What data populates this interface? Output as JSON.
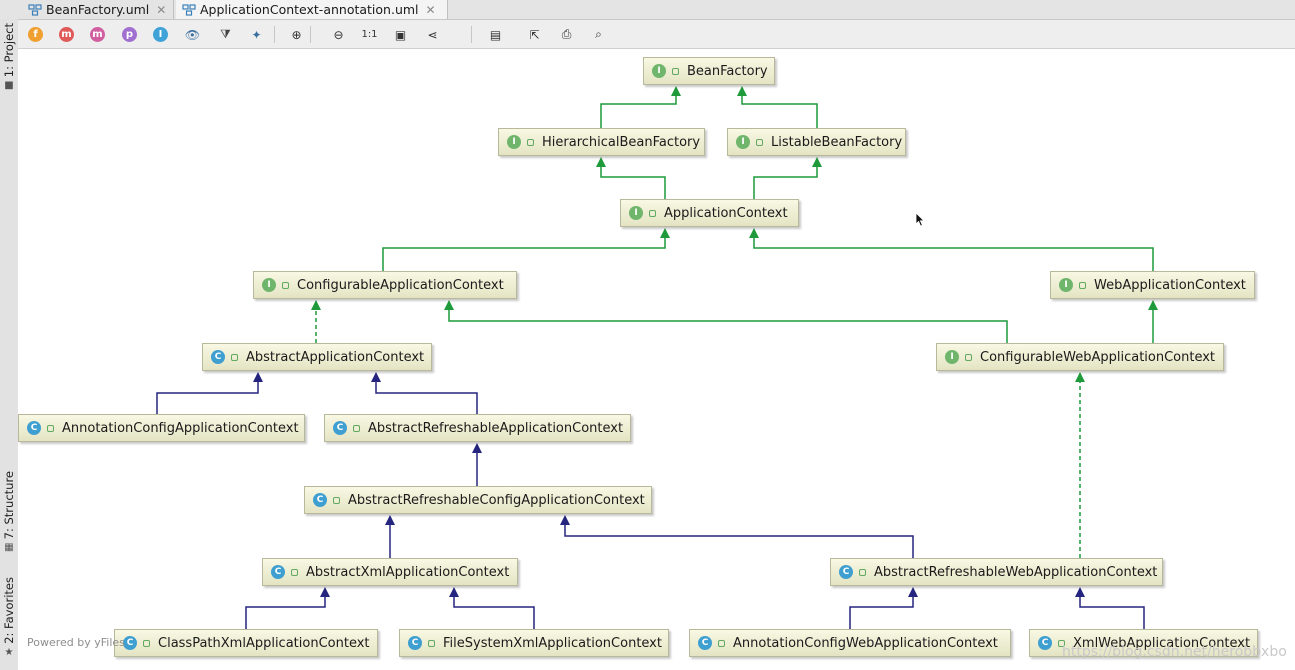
{
  "tabs": [
    {
      "label": "BeanFactory.uml",
      "active": false
    },
    {
      "label": "ApplicationContext-annotation.uml",
      "active": true
    }
  ],
  "sidebar": [
    {
      "label": "1: Project",
      "icon": "folder-icon"
    },
    {
      "label": "7: Structure",
      "icon": "structure-icon"
    },
    {
      "label": "2: Favorites",
      "icon": "star-icon"
    }
  ],
  "toolbar": [
    {
      "name": "fields-toggle",
      "glyph": "f",
      "color": "#f0a030"
    },
    {
      "name": "constructors-toggle",
      "glyph": "m",
      "color": "#e05a5a"
    },
    {
      "name": "methods-toggle",
      "glyph": "m",
      "color": "#d060a0"
    },
    {
      "name": "properties-toggle",
      "glyph": "p",
      "color": "#a070d0"
    },
    {
      "name": "inner-classes-toggle",
      "glyph": "I",
      "color": "#3fa3d8"
    },
    {
      "name": "visibility",
      "glyph": "👁",
      "color": "#3a6fa0"
    },
    {
      "name": "filter",
      "glyph": "⧩",
      "color": "#444444"
    },
    {
      "name": "layout",
      "glyph": "✦",
      "color": "#3a6fa0"
    },
    {
      "name": "zoom-in",
      "glyph": "⊕",
      "color": "#333333"
    },
    {
      "name": "zoom-out",
      "glyph": "⊖",
      "color": "#333333"
    },
    {
      "name": "actual-size",
      "glyph": "1:1",
      "color": "#333333"
    },
    {
      "name": "fit-content",
      "glyph": "▣",
      "color": "#333333"
    },
    {
      "name": "share",
      "glyph": "⋖",
      "color": "#333333"
    },
    {
      "name": "save",
      "glyph": "▤",
      "color": "#333333"
    },
    {
      "name": "export",
      "glyph": "⇱",
      "color": "#333333"
    },
    {
      "name": "print",
      "glyph": "⎙",
      "color": "#333333"
    },
    {
      "name": "print-preview",
      "glyph": "⌕",
      "color": "#333333"
    }
  ],
  "diagram": {
    "nodes": [
      {
        "id": "BeanFactory",
        "label": "BeanFactory",
        "kind": "I"
      },
      {
        "id": "HierarchicalBeanFactory",
        "label": "HierarchicalBeanFactory",
        "kind": "I"
      },
      {
        "id": "ListableBeanFactory",
        "label": "ListableBeanFactory",
        "kind": "I"
      },
      {
        "id": "ApplicationContext",
        "label": "ApplicationContext",
        "kind": "I"
      },
      {
        "id": "ConfigurableApplicationContext",
        "label": "ConfigurableApplicationContext",
        "kind": "I"
      },
      {
        "id": "WebApplicationContext",
        "label": "WebApplicationContext",
        "kind": "I"
      },
      {
        "id": "AbstractApplicationContext",
        "label": "AbstractApplicationContext",
        "kind": "C"
      },
      {
        "id": "ConfigurableWebApplicationContext",
        "label": "ConfigurableWebApplicationContext",
        "kind": "I"
      },
      {
        "id": "AnnotationConfigApplicationContext",
        "label": "AnnotationConfigApplicationContext",
        "kind": "C"
      },
      {
        "id": "AbstractRefreshableApplicationContext",
        "label": "AbstractRefreshableApplicationContext",
        "kind": "C"
      },
      {
        "id": "AbstractRefreshableConfigApplicationContext",
        "label": "AbstractRefreshableConfigApplicationContext",
        "kind": "C"
      },
      {
        "id": "AbstractXmlApplicationContext",
        "label": "AbstractXmlApplicationContext",
        "kind": "C"
      },
      {
        "id": "AbstractRefreshableWebApplicationContext",
        "label": "AbstractRefreshableWebApplicationContext",
        "kind": "C"
      },
      {
        "id": "ClassPathXmlApplicationContext",
        "label": "ClassPathXmlApplicationContext",
        "kind": "C"
      },
      {
        "id": "FileSystemXmlApplicationContext",
        "label": "FileSystemXmlApplicationContext",
        "kind": "C"
      },
      {
        "id": "AnnotationConfigWebApplicationContext",
        "label": "AnnotationConfigWebApplicationContext",
        "kind": "C"
      },
      {
        "id": "XmlWebApplicationContext",
        "label": "XmlWebApplicationContext",
        "kind": "C"
      }
    ],
    "edges": [
      {
        "from": "HierarchicalBeanFactory",
        "to": "BeanFactory",
        "type": "interface-extends"
      },
      {
        "from": "ListableBeanFactory",
        "to": "BeanFactory",
        "type": "interface-extends"
      },
      {
        "from": "ApplicationContext",
        "to": "HierarchicalBeanFactory",
        "type": "interface-extends"
      },
      {
        "from": "ApplicationContext",
        "to": "ListableBeanFactory",
        "type": "interface-extends"
      },
      {
        "from": "ConfigurableApplicationContext",
        "to": "ApplicationContext",
        "type": "interface-extends"
      },
      {
        "from": "WebApplicationContext",
        "to": "ApplicationContext",
        "type": "interface-extends"
      },
      {
        "from": "AbstractApplicationContext",
        "to": "ConfigurableApplicationContext",
        "type": "implements"
      },
      {
        "from": "ConfigurableWebApplicationContext",
        "to": "ConfigurableApplicationContext",
        "type": "interface-extends"
      },
      {
        "from": "ConfigurableWebApplicationContext",
        "to": "WebApplicationContext",
        "type": "interface-extends"
      },
      {
        "from": "AnnotationConfigApplicationContext",
        "to": "AbstractApplicationContext",
        "type": "class-extends"
      },
      {
        "from": "AbstractRefreshableApplicationContext",
        "to": "AbstractApplicationContext",
        "type": "class-extends"
      },
      {
        "from": "AbstractRefreshableConfigApplicationContext",
        "to": "AbstractRefreshableApplicationContext",
        "type": "class-extends"
      },
      {
        "from": "AbstractXmlApplicationContext",
        "to": "AbstractRefreshableConfigApplicationContext",
        "type": "class-extends"
      },
      {
        "from": "AbstractRefreshableWebApplicationContext",
        "to": "AbstractRefreshableConfigApplicationContext",
        "type": "class-extends"
      },
      {
        "from": "AbstractRefreshableWebApplicationContext",
        "to": "ConfigurableWebApplicationContext",
        "type": "implements"
      },
      {
        "from": "ClassPathXmlApplicationContext",
        "to": "AbstractXmlApplicationContext",
        "type": "class-extends"
      },
      {
        "from": "FileSystemXmlApplicationContext",
        "to": "AbstractXmlApplicationContext",
        "type": "class-extends"
      },
      {
        "from": "AnnotationConfigWebApplicationContext",
        "to": "AbstractRefreshableWebApplicationContext",
        "type": "class-extends"
      },
      {
        "from": "XmlWebApplicationContext",
        "to": "AbstractRefreshableWebApplicationContext",
        "type": "class-extends"
      }
    ]
  },
  "footer": {
    "powered_by": "Powered by yFiles",
    "watermark": "https://blog.csdn.net/herobbxbo"
  },
  "colors": {
    "interface_edge": "#1e9a3a",
    "class_edge": "#25257f",
    "interface_badge": "#6fb56b",
    "class_badge": "#3f9fd0"
  }
}
